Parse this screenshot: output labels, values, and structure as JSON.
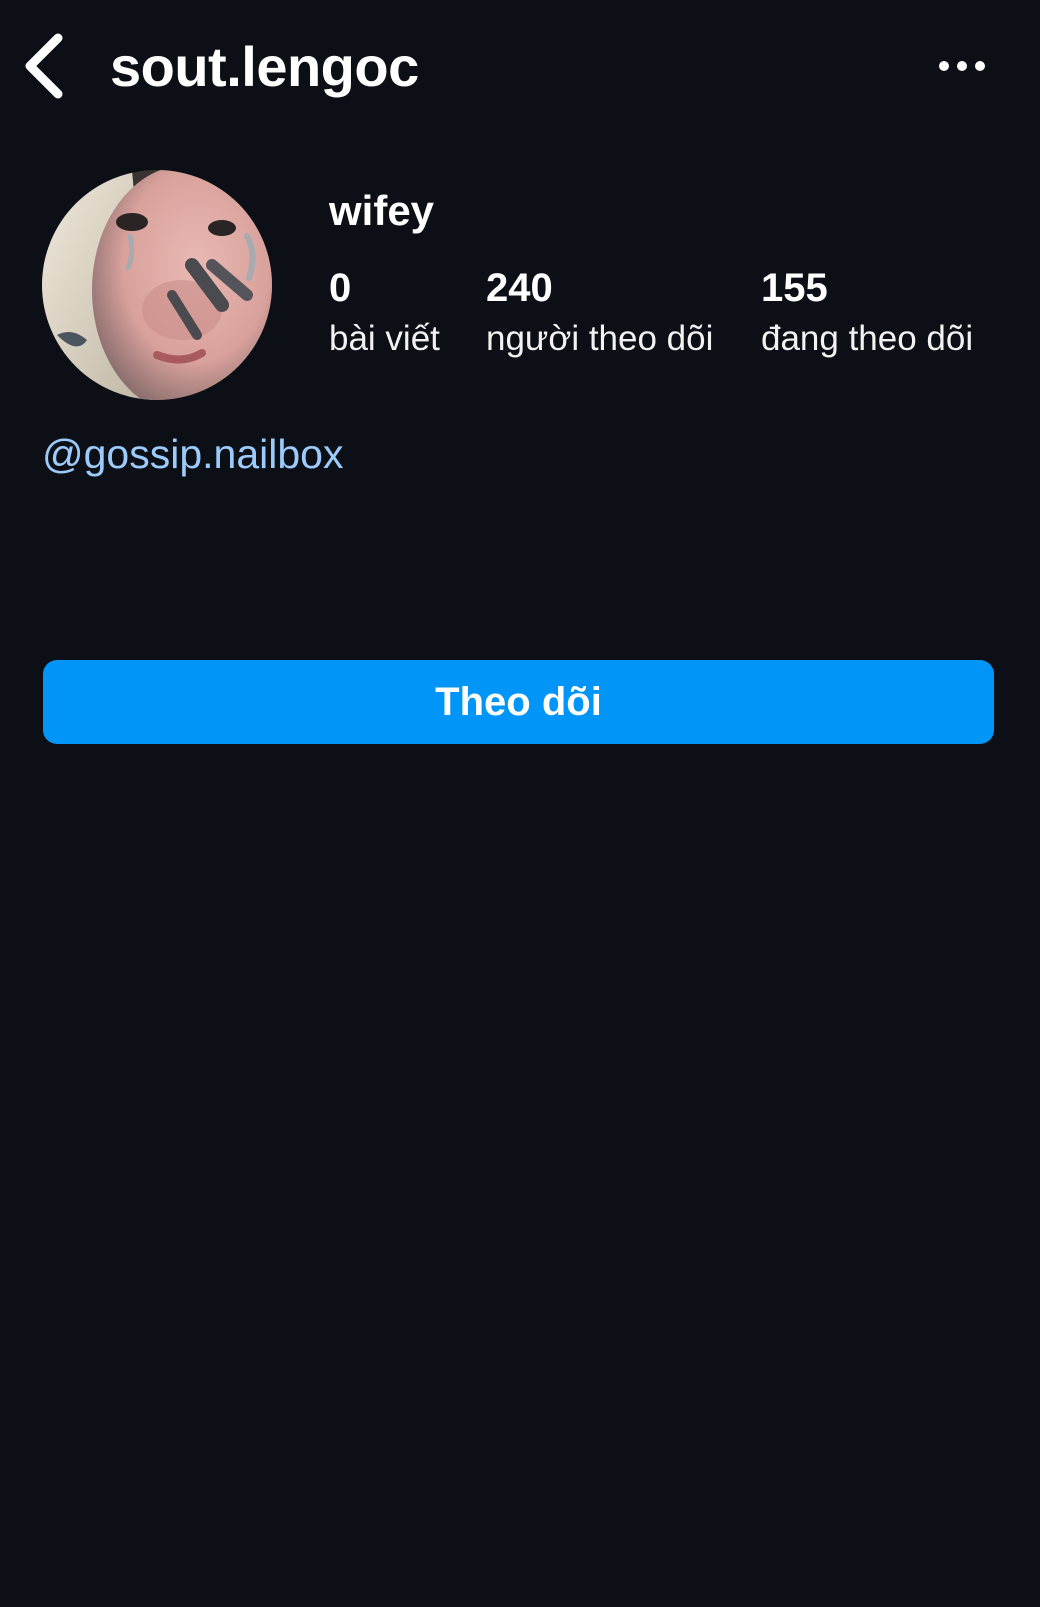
{
  "header": {
    "back_icon": "chevron-left-icon",
    "username": "sout.lengoc",
    "more_icon": "more-horizontal-icon"
  },
  "profile": {
    "display_name": "wifey",
    "stats": [
      {
        "value": "0",
        "label": "bài viết"
      },
      {
        "value": "240",
        "label": "người theo dõi"
      },
      {
        "value": "155",
        "label": "đang theo dõi"
      }
    ],
    "bio_link": "@gossip.nailbox"
  },
  "actions": {
    "follow_label": "Theo dõi"
  },
  "colors": {
    "background": "#0c0f15",
    "text": "#ffffff",
    "link": "#9ccbfb",
    "button": "#0095f6"
  }
}
